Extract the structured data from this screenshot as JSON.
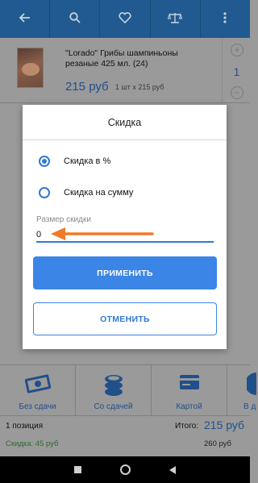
{
  "topbar": {
    "icons": [
      "back-arrow-icon",
      "search-icon",
      "heart-icon",
      "scales-icon",
      "more-icon"
    ]
  },
  "product": {
    "name": "\"Lorado\" Грибы шампиньоны резаные 425 мл. (24)",
    "price": "215 руб",
    "qty_line": "1 шт х 215 руб",
    "count": "1"
  },
  "dialog": {
    "title": "Скидка",
    "options": [
      {
        "label": "Скидка в %",
        "selected": true
      },
      {
        "label": "Скидка на сумму",
        "selected": false
      }
    ],
    "field_label": "Размер скидки",
    "field_value": "0",
    "apply_label": "ПРИМЕНИТЬ",
    "cancel_label": "ОТМЕНИТЬ",
    "accent_color": "#3b85e6"
  },
  "payment_options": [
    {
      "label": "Без сдачи",
      "icon": "cash-icon"
    },
    {
      "label": "Со сдачей",
      "icon": "coins-icon"
    },
    {
      "label": "Картой",
      "icon": "card-icon"
    },
    {
      "label": "В д",
      "icon": "partial-icon"
    }
  ],
  "summary": {
    "positions": "1 позиция",
    "total_label": "Итого:",
    "total_value": "215 руб",
    "discount": "Скидка: 45 руб",
    "subtotal": "260 руб"
  },
  "navbar": {
    "icons": [
      "recents-icon",
      "home-icon",
      "back-icon"
    ]
  }
}
